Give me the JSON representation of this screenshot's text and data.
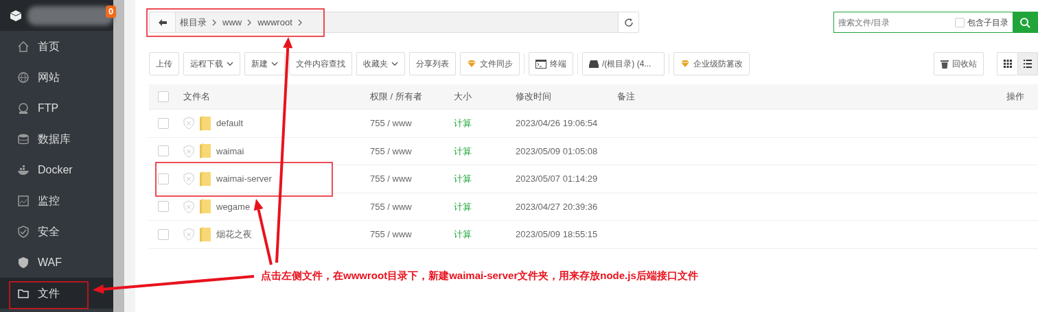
{
  "sidebar": {
    "badge": "0",
    "items": [
      {
        "label": "首页",
        "selected": false
      },
      {
        "label": "网站",
        "selected": false
      },
      {
        "label": "FTP",
        "selected": false
      },
      {
        "label": "数据库",
        "selected": false
      },
      {
        "label": "Docker",
        "selected": false
      },
      {
        "label": "监控",
        "selected": false
      },
      {
        "label": "安全",
        "selected": false
      },
      {
        "label": "WAF",
        "selected": false
      },
      {
        "label": "文件",
        "selected": true
      }
    ]
  },
  "breadcrumb": [
    "根目录",
    "www",
    "wwwroot"
  ],
  "search": {
    "placeholder": "搜索文件/目录",
    "option": {
      "label": "包含子目录",
      "checked": false
    }
  },
  "toolbar": [
    {
      "label": "上传",
      "kind": "text"
    },
    {
      "label": "远程下载",
      "kind": "dropdown"
    },
    {
      "label": "新建",
      "kind": "dropdown"
    },
    {
      "label": "文件内容查找",
      "kind": "text"
    },
    {
      "label": "收藏夹",
      "kind": "dropdown"
    },
    {
      "label": "分享列表",
      "kind": "text"
    },
    {
      "label": "文件同步",
      "kind": "gem"
    },
    {
      "label": "终端",
      "kind": "terminal"
    },
    {
      "label": "/(根目录) (4...",
      "kind": "disk"
    },
    {
      "label": "企业级防篡改",
      "kind": "gem"
    }
  ],
  "recycle": {
    "label": "回收站"
  },
  "view_toggle": [
    {
      "selected": false
    },
    {
      "selected": true
    }
  ],
  "table": {
    "all_checked": false,
    "columns": [
      "文件名",
      "权限 / 所有者",
      "大小",
      "修改时间",
      "备注",
      "操作"
    ],
    "rows": [
      {
        "checked": false,
        "name": "default",
        "perm": "755 / www",
        "size": "计算",
        "mtime": "2023/04/26 19:06:54"
      },
      {
        "checked": false,
        "name": "waimai",
        "perm": "755 / www",
        "size": "计算",
        "mtime": "2023/05/09 01:05:08"
      },
      {
        "checked": false,
        "name": "waimai-server",
        "perm": "755 / www",
        "size": "计算",
        "mtime": "2023/05/07 01:14:29"
      },
      {
        "checked": false,
        "name": "wegame",
        "perm": "755 / www",
        "size": "计算",
        "mtime": "2023/04/27 20:39:36"
      },
      {
        "checked": false,
        "name": "烟花之夜",
        "perm": "755 / www",
        "size": "计算",
        "mtime": "2023/05/09 18:55:15"
      }
    ]
  },
  "annotation": {
    "text": "点击左侧文件，在wwwroot目录下，新建waimai-server文件夹，用来存放node.js后端接口文件"
  }
}
